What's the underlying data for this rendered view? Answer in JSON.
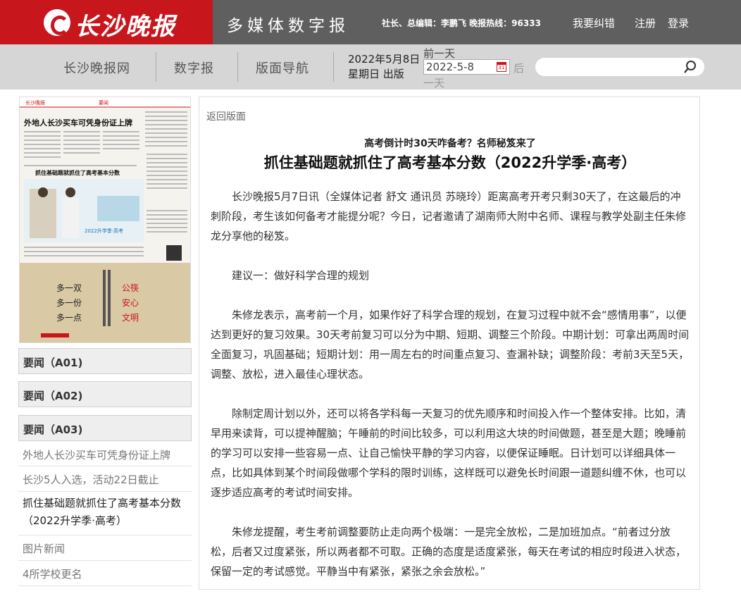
{
  "header": {
    "logo_text": "长沙晚报",
    "site_title": "多媒体数字报",
    "editors": "社长、总编辑：李鹏飞 晚报热线：96333",
    "links": [
      "我要纠错",
      "注册",
      "登录"
    ]
  },
  "nav": {
    "items": [
      "长沙晚报网",
      "数字报",
      "版面导航"
    ],
    "date_line1": "2022年5月8日",
    "date_line2": "星期日 出版",
    "prev_day": "前一天",
    "date_value": "2022-5-8",
    "next_a": "后",
    "next_b": "一天",
    "search_placeholder": ""
  },
  "thumbnail": {
    "masthead": "长沙晚报",
    "section": "要闻",
    "headline1": "外地人长沙买车可凭身份证上牌",
    "headline2": "抓住基础题就抓住了高考基本分数",
    "banner": "2022升学季·高考",
    "slogan": [
      "多一双",
      "多一份",
      "多一点"
    ],
    "slogan2": [
      "公筷",
      "安心",
      "文明"
    ]
  },
  "sidebar": {
    "sections": [
      "要闻（A01)",
      "要闻（A02)",
      "要闻（A03)"
    ],
    "articles": [
      "外地人长沙买车可凭身份证上牌",
      "长沙5人入选，活动22日截止",
      "抓住基础题就抓住了高考基本分数（2022升学季·高考）",
      "图片新闻",
      "4所学校更名"
    ]
  },
  "article": {
    "back": "返回版面",
    "subtitle": "高考倒计时30天咋备考？名师秘笈来了",
    "headline": "抓住基础题就抓住了高考基本分数（2022升学季·高考）",
    "paragraphs": [
      "长沙晚报5月7日讯（全媒体记者 舒文 通讯员 苏晓玲）距离高考开考只剩30天了，在这最后的冲刺阶段，考生该如何备考才能提分呢？今日，记者邀请了湖南师大附中名师、课程与教学处副主任朱修龙分享他的秘笈。",
      "建议一：做好科学合理的规划",
      "朱修龙表示，高考前一个月，如果作好了科学合理的规划，在复习过程中就不会“感情用事”，以便达到更好的复习效果。30天考前复习可以分为中期、短期、调整三个阶段。中期计划：可拿出两周时间全面复习，巩固基础；短期计划：用一周左右的时间重点复习、查漏补缺；调整阶段：考前3天至5天，调整、放松，进入最佳心理状态。",
      "除制定周计划以外，还可以将各学科每一天复习的优先顺序和时间投入作一个整体安排。比如，清早用来读背，可以提神醒脑；午睡前的时间比较多，可以利用这大块的时间做题，甚至是大题；晚睡前的学习可以安排一些容易一点、让自己愉快平静的学习内容，以便保证睡眠。日计划可以详细具体一点，比如具体到某个时间段做哪个学科的限时训练，这样既可以避免长时间跟一道题纠缠不休，也可以逐步适应高考的考试时间安排。",
      "朱修龙提醒，考生考前调整要防止走向两个极端：一是完全放松，二是加班加点。“前者过分放松，后者又过度紧张，所以两者都不可取。正确的态度是适度紧张，每天在考试的相应时段进入状态，保留一定的考试感觉。平静当中有紧张，紧张之余会放松。”"
    ]
  }
}
